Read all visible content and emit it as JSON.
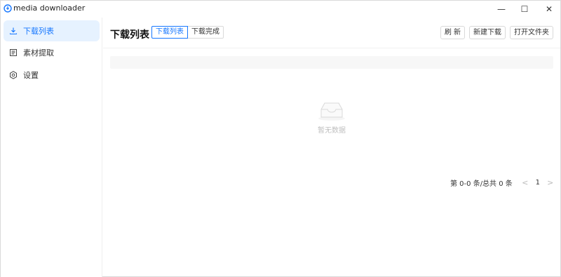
{
  "window": {
    "title": "media downloader",
    "controls": {
      "minimize": "—",
      "maximize": "☐",
      "close": "✕"
    }
  },
  "sidebar": {
    "items": [
      {
        "label": "下载列表",
        "icon": "download-icon",
        "active": true
      },
      {
        "label": "素材提取",
        "icon": "document-icon",
        "active": false
      },
      {
        "label": "设置",
        "icon": "gear-icon",
        "active": false
      }
    ]
  },
  "header": {
    "title": "下载列表",
    "tabs": [
      {
        "label": "下载列表",
        "active": true
      },
      {
        "label": "下载完成",
        "active": false
      }
    ],
    "actions": {
      "refresh": "刷 新",
      "new_download": "新建下载",
      "open_folder": "打开文件夹"
    }
  },
  "table": {
    "empty_text": "暂无数据"
  },
  "pagination": {
    "total_text": "第 0-0 条/总共 0 条",
    "prev": "<",
    "current_page": "1",
    "next": ">"
  },
  "colors": {
    "accent": "#1677ff",
    "active_bg": "#e6f2ff"
  }
}
